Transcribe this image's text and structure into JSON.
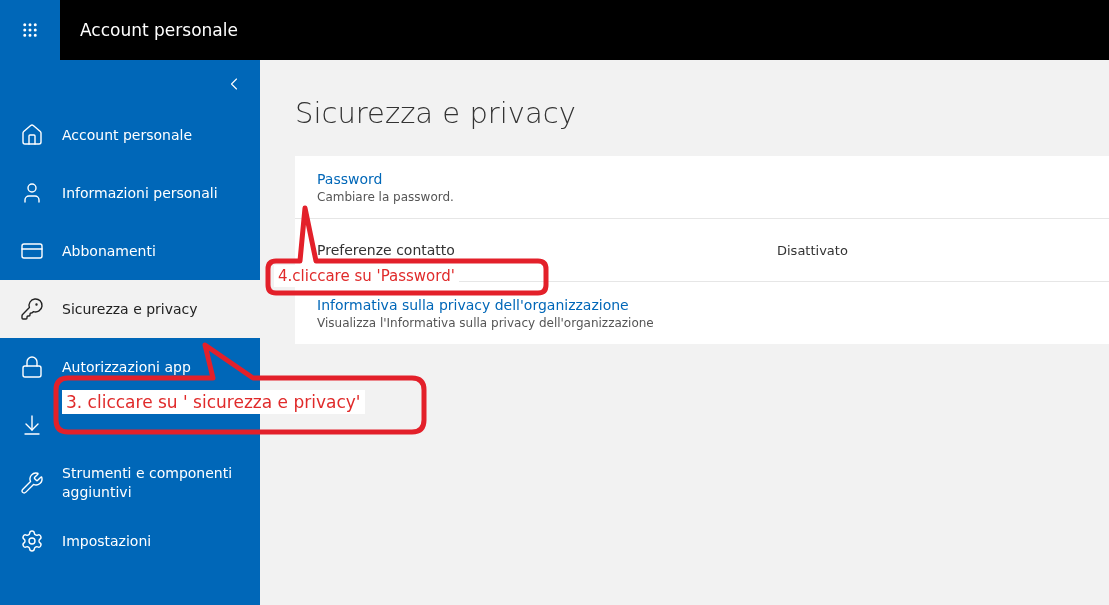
{
  "header": {
    "title": "Account personale"
  },
  "sidebar": {
    "items": [
      {
        "label": "Account personale",
        "selected": false
      },
      {
        "label": "Informazioni personali",
        "selected": false
      },
      {
        "label": "Abbonamenti",
        "selected": false
      },
      {
        "label": "Sicurezza e privacy",
        "selected": true
      },
      {
        "label": "Autorizzazioni app",
        "selected": false
      },
      {
        "selected": false
      },
      {
        "label": "Strumenti e componenti aggiuntivi",
        "selected": false
      },
      {
        "label": "Impostazioni",
        "selected": false
      }
    ]
  },
  "page": {
    "title": "Sicurezza e privacy",
    "rows": [
      {
        "title": "Password",
        "link": true,
        "description": "Cambiare la password."
      },
      {
        "title": "Preferenze contatto",
        "link": false,
        "value": "Disattivato"
      },
      {
        "title": "Informativa sulla privacy dell'organizzazione",
        "link": true,
        "description": "Visualizza l'Informativa sulla privacy dell'organizzazione"
      }
    ]
  },
  "annotations": [
    {
      "text": "4.cliccare su 'Password'"
    },
    {
      "text": "3. cliccare su ' sicurezza e privacy'"
    }
  ]
}
